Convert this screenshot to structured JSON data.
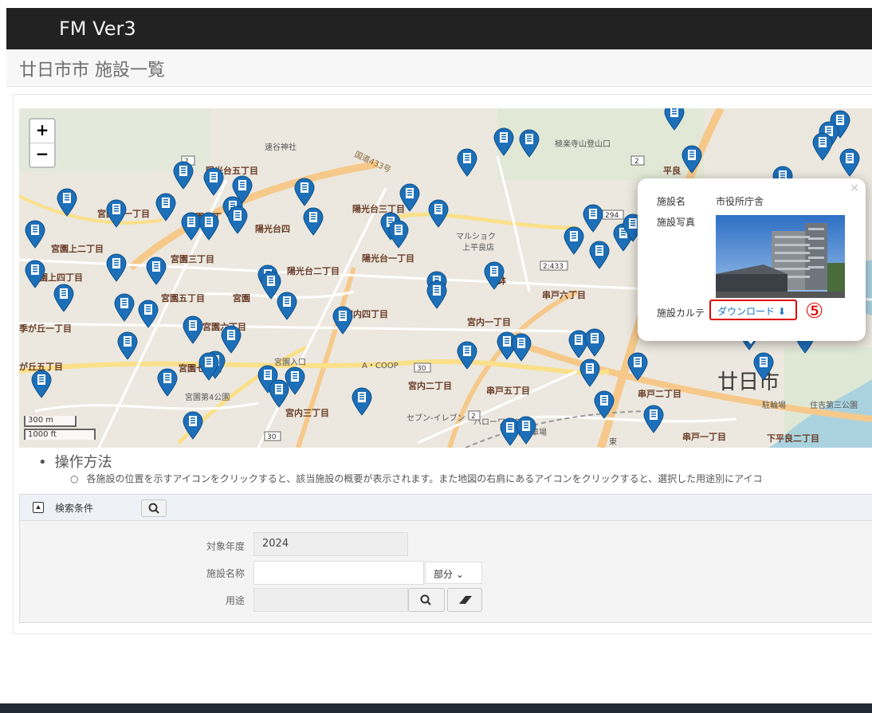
{
  "app": {
    "title": "FM Ver3"
  },
  "page": {
    "title": "廿日市市 施設一覧"
  },
  "map": {
    "zoom_in": "+",
    "zoom_out": "−",
    "scale_metric": "300 m",
    "scale_imperial": "1000 ft",
    "labels": [
      "陽光台五丁目",
      "宮園上一丁目",
      "宮園一丁",
      "陽光台三丁目",
      "陽光台四",
      "宮園上二丁目",
      "宮園三丁目",
      "陽光台一丁目",
      "宮園上四丁目",
      "陽光台二丁目",
      "宮園五丁目",
      "宮園",
      "宮内四丁目",
      "宮内一丁目",
      "宮園六丁目",
      "季が丘一丁目",
      "が丘五丁目",
      "宮園七丁目",
      "宮内二丁目",
      "串戸五丁目",
      "串戸二丁目",
      "宮内三丁目",
      "串戸一丁目",
      "下平良二丁目",
      "串戸六丁目",
      "廿日市",
      "平良",
      "速谷神社",
      "極楽寺山登山口",
      "マルショク上平良店",
      "宮園第4公園",
      "セブン-イレブン",
      "ハローワーク",
      "A・COOP",
      "宮園入口",
      "住吉第三公園",
      "駐輪場",
      "専用駐車場",
      "国道433号",
      "鉢",
      "東"
    ],
    "road_numbers": [
      "2",
      "2",
      "30",
      "30",
      "294",
      "2;433",
      "2"
    ]
  },
  "popup": {
    "close": "×",
    "name_label": "施設名",
    "name_value": "市役所庁舎",
    "photo_label": "施設写真",
    "karte_label": "施設カルテ",
    "download_label": "ダウンロード ⬇",
    "annotation": "⑤"
  },
  "help": {
    "title": "操作方法",
    "text": "各施設の位置を示すアイコンをクリックすると、該当施設の概要が表示されます。また地図の右肩にあるアイコンをクリックすると、選択した用途別にアイコ"
  },
  "search": {
    "header_label": "検索条件",
    "year_label": "対象年度",
    "year_value": "2024",
    "name_label": "施設名称",
    "name_value": "",
    "match_select": "部分 ⌄",
    "use_label": "用途",
    "use_value": ""
  },
  "colors": {
    "marker": "#1d6fb8",
    "topbar": "#222222",
    "highlight": "#e00000",
    "link": "#1a73c9"
  }
}
